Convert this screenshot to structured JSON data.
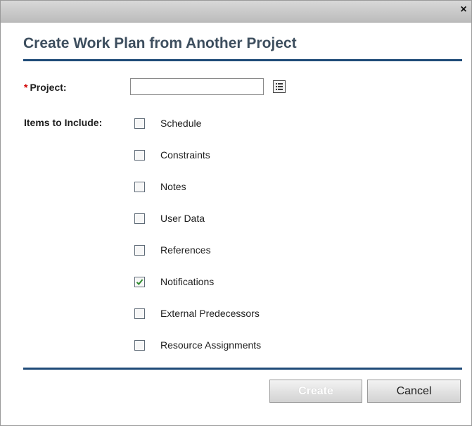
{
  "window": {
    "close_glyph": "×",
    "close_icon": "close-icon"
  },
  "dialog": {
    "title": "Create Work Plan from Another Project"
  },
  "form": {
    "project": {
      "required_marker": "*",
      "label": "Project:",
      "value": "",
      "picker_icon": "list-picker-icon"
    },
    "items_label": "Items to Include:",
    "items": [
      {
        "label": "Schedule",
        "checked": false
      },
      {
        "label": "Constraints",
        "checked": false
      },
      {
        "label": "Notes",
        "checked": false
      },
      {
        "label": "User Data",
        "checked": false
      },
      {
        "label": "References",
        "checked": false
      },
      {
        "label": "Notifications",
        "checked": true
      },
      {
        "label": "External Predecessors",
        "checked": false
      },
      {
        "label": "Resource Assignments",
        "checked": false
      }
    ]
  },
  "buttons": {
    "create_label": "Create",
    "create_disabled": true,
    "cancel_label": "Cancel"
  },
  "colors": {
    "heading": "#3d4e5e",
    "rule": "#1f4b78",
    "required": "#d10000",
    "check": "#2e8b2e"
  }
}
